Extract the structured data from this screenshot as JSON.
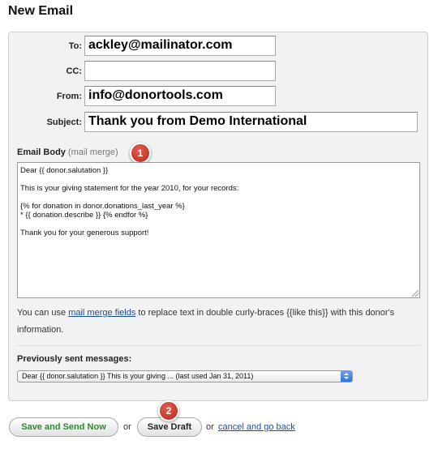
{
  "page": {
    "title": "New Email"
  },
  "form": {
    "to": {
      "label": "To:",
      "value": "ackley@mailinator.com"
    },
    "cc": {
      "label": "CC:",
      "value": ""
    },
    "from": {
      "label": "From:",
      "value": "info@donortools.com"
    },
    "subject": {
      "label": "Subject:",
      "value": "Thank you from Demo International"
    },
    "body": {
      "label": "Email Body",
      "sublabel": "(mail merge)",
      "badge": "1",
      "value": "Dear {{ donor.salutation }}\n\nThis is your giving statement for the year 2010, for your records:\n\n{% for donation in donor.donations_last_year %}\n* {{ donation.describe }} {% endfor %}\n\nThank you for your generous support!"
    },
    "help": {
      "prefix": "You can use ",
      "link": "mail merge fields",
      "suffix": " to replace text in double curly-braces {{like this}} with this donor's information."
    },
    "previous": {
      "label": "Previously sent messages:",
      "selected": "Dear {{ donor.salutation }} This is your giving ... (last used Jan 31, 2011)"
    }
  },
  "actions": {
    "send_label": "Save and Send Now",
    "or1": "or",
    "draft_label": "Save Draft",
    "draft_badge": "2",
    "or2": "or",
    "cancel_label": "cancel and go back"
  }
}
